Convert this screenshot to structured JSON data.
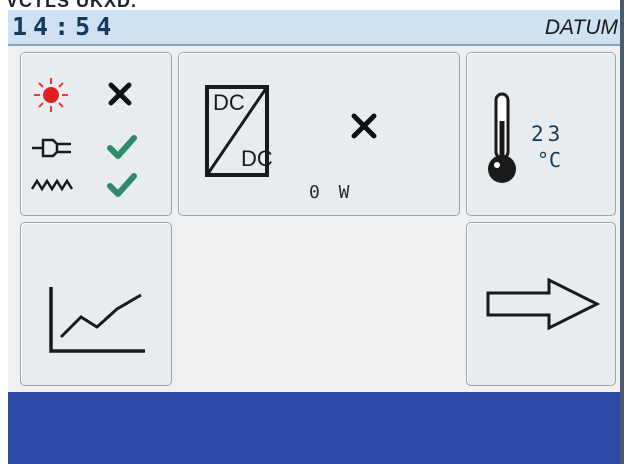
{
  "top_overlay": {
    "text": "VCTLS UKXD."
  },
  "status_bar": {
    "time": "14:54",
    "date_label": "DATUM"
  },
  "status_panel": {
    "rows": [
      {
        "icon": "sun-icon",
        "state": "error",
        "state_icon": "cross-icon"
      },
      {
        "icon": "plug-icon",
        "state": "ok",
        "state_icon": "check-icon"
      },
      {
        "icon": "grid-wave-icon",
        "state": "ok",
        "state_icon": "check-icon"
      }
    ],
    "colors": {
      "cross": "#111111",
      "check": "#2f8a6a",
      "sun": "#e02020"
    }
  },
  "dcdc_panel": {
    "top_label": "DC",
    "bottom_label": "DC",
    "state_icon": "cross-icon",
    "power_text": "0 W"
  },
  "temperature_panel": {
    "value": "23",
    "unit": "°C",
    "icon": "thermometer-icon"
  },
  "graph_button": {
    "icon": "line-chart-icon"
  },
  "next_button": {
    "icon": "arrow-right-icon"
  },
  "footer": {
    "color": "#2d4aa6"
  }
}
